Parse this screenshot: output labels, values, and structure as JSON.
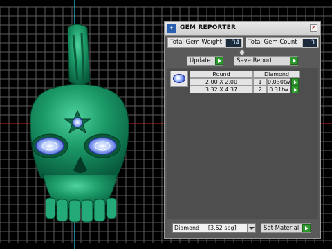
{
  "panel": {
    "title": "GEM REPORTER",
    "close_glyph": "×",
    "app_icon": "gem-reporter-icon",
    "total_weight_label": "Total Gem Weight",
    "total_weight_value": ".34",
    "total_count_label": "Total Gem Count",
    "total_count_value": "3",
    "update_label": "Update",
    "save_report_label": "Save Report",
    "table": {
      "headers": [
        "Round",
        "Diamond"
      ],
      "rows": [
        {
          "size": "2.00 X 2.00",
          "count": "1",
          "weight": "0.030tw"
        },
        {
          "size": "3.32 X 4.37",
          "count": "2",
          "weight": "0.31tw"
        }
      ]
    },
    "material_value": "Diamond     [3.52 spg]",
    "set_material_label": "Set Material"
  },
  "colors": {
    "model": "#1f9a6a",
    "gem": "#9db6ff",
    "grid": "#5c5c5c",
    "axis_x": "#d22222",
    "axis_y": "#1aa6b7",
    "go_button": "#2e9a2e"
  }
}
